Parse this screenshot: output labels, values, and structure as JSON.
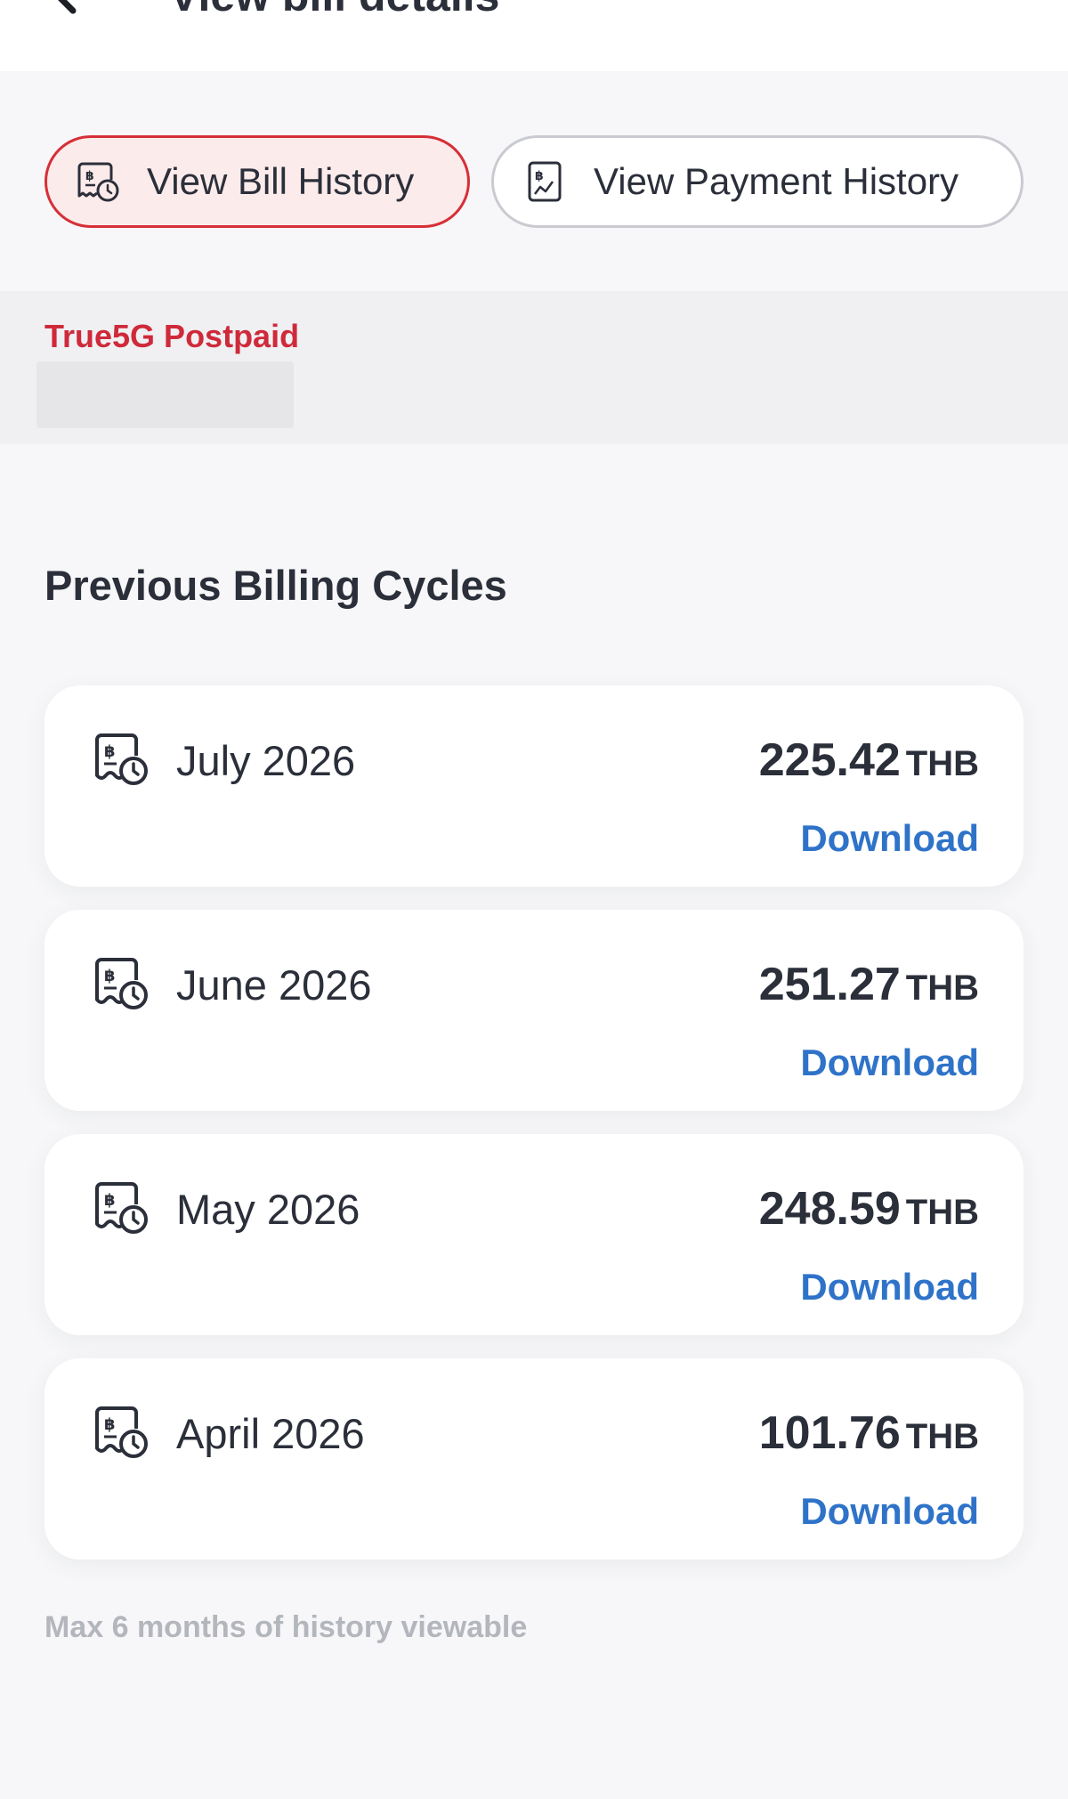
{
  "header": {
    "title": "View bill details"
  },
  "toggle": {
    "bill_history_label": "View Bill History",
    "payment_history_label": "View Payment History"
  },
  "account": {
    "plan_name": "True5G Postpaid"
  },
  "section": {
    "title": "Previous Billing Cycles"
  },
  "bills": [
    {
      "month": "July 2026",
      "amount": "225.42",
      "currency": "THB",
      "action": "Download"
    },
    {
      "month": "June 2026",
      "amount": "251.27",
      "currency": "THB",
      "action": "Download"
    },
    {
      "month": "May 2026",
      "amount": "248.59",
      "currency": "THB",
      "action": "Download"
    },
    {
      "month": "April 2026",
      "amount": "101.76",
      "currency": "THB",
      "action": "Download"
    }
  ],
  "footnote": "Max 6 months of history viewable",
  "colors": {
    "accent_red": "#d62f37",
    "plan_red": "#cf2a3a",
    "link_blue": "#2f73c9",
    "text_dark": "#2b2f3a",
    "muted": "#b4b6bd"
  },
  "icons": {
    "back": "chevron-left-icon",
    "bill_history": "bill-clock-icon",
    "payment_history": "receipt-baht-icon",
    "bill_row": "bill-clock-icon"
  }
}
